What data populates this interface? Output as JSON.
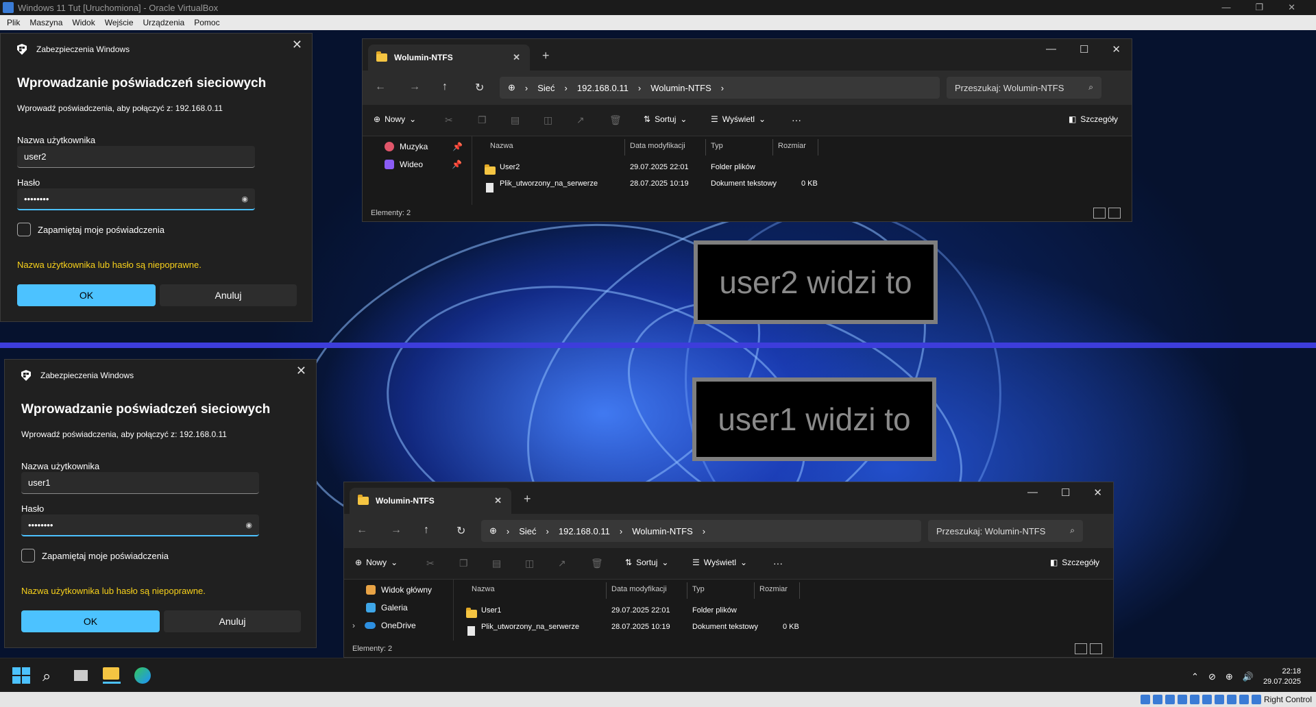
{
  "vbox": {
    "title": "Windows 11 Tut [Uruchomiona] - Oracle VirtualBox",
    "menu": [
      "Plik",
      "Maszyna",
      "Widok",
      "Wejście",
      "Urządzenia",
      "Pomoc"
    ],
    "min": "—",
    "restore": "❐",
    "close": "✕",
    "host_key": "Right Control"
  },
  "dialog_top": {
    "app": "Zabezpieczenia Windows",
    "title": "Wprowadzanie poświadczeń sieciowych",
    "subtitle": "Wprowadź poświadczenia, aby połączyć z: 192.168.0.11",
    "user_label": "Nazwa użytkownika",
    "user_value": "user2",
    "pw_label": "Hasło",
    "pw_value": "••••••••",
    "remember": "Zapamiętaj moje poświadczenia",
    "error": "Nazwa użytkownika lub hasło są niepoprawne.",
    "ok": "OK",
    "cancel": "Anuluj"
  },
  "dialog_bottom": {
    "app": "Zabezpieczenia Windows",
    "title": "Wprowadzanie poświadczeń sieciowych",
    "subtitle": "Wprowadź poświadczenia, aby połączyć z: 192.168.0.11",
    "user_label": "Nazwa użytkownika",
    "user_value": "user1",
    "pw_label": "Hasło",
    "pw_value": "••••••••",
    "remember": "Zapamiętaj moje poświadczenia",
    "error": "Nazwa użytkownika lub hasło są niepoprawne.",
    "ok": "OK",
    "cancel": "Anuluj"
  },
  "explorer_top": {
    "tab": "Wolumin-NTFS",
    "breadcrumb": [
      "Sieć",
      "192.168.0.11",
      "Wolumin-NTFS"
    ],
    "search": "Przeszukaj: Wolumin-NTFS",
    "new": "Nowy",
    "sort": "Sortuj",
    "view": "Wyświetl",
    "details": "Szczegóły",
    "sidebar": [
      "Muzyka",
      "Wideo"
    ],
    "columns": [
      "Nazwa",
      "Data modyfikacji",
      "Typ",
      "Rozmiar"
    ],
    "rows": [
      {
        "name": "User2",
        "date": "29.07.2025 22:01",
        "type": "Folder plików",
        "size": ""
      },
      {
        "name": "Plik_utworzony_na_serwerze",
        "date": "28.07.2025 10:19",
        "type": "Dokument tekstowy",
        "size": "0 KB"
      }
    ],
    "status": "Elementy: 2"
  },
  "explorer_bottom": {
    "tab": "Wolumin-NTFS",
    "breadcrumb": [
      "Sieć",
      "192.168.0.11",
      "Wolumin-NTFS"
    ],
    "search": "Przeszukaj: Wolumin-NTFS",
    "new": "Nowy",
    "sort": "Sortuj",
    "view": "Wyświetl",
    "details": "Szczegóły",
    "sidebar": [
      "Widok główny",
      "Galeria",
      "OneDrive"
    ],
    "columns": [
      "Nazwa",
      "Data modyfikacji",
      "Typ",
      "Rozmiar"
    ],
    "rows": [
      {
        "name": "User1",
        "date": "29.07.2025 22:01",
        "type": "Folder plików",
        "size": ""
      },
      {
        "name": "Plik_utworzony_na_serwerze",
        "date": "28.07.2025 10:19",
        "type": "Dokument tekstowy",
        "size": "0 KB"
      }
    ],
    "status": "Elementy: 2"
  },
  "banners": {
    "top": "user2 widzi to",
    "bottom": "user1 widzi to"
  },
  "taskbar": {
    "time": "22:18",
    "date": "29.07.2025"
  }
}
